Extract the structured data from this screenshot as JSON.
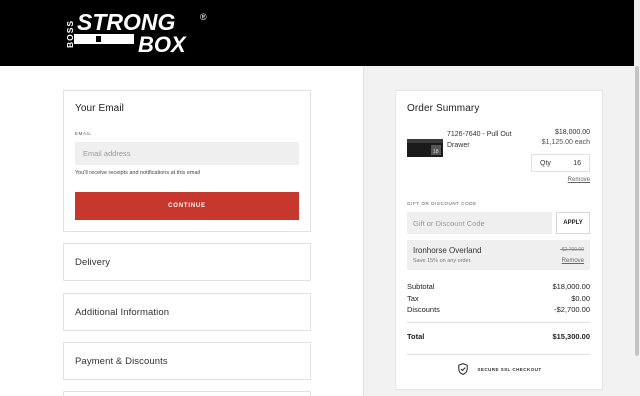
{
  "header": {
    "logo": {
      "wordmark_top": "STRONG",
      "wordmark_bottom": "BOX",
      "registered": "®",
      "vertical_text": "BOSS"
    }
  },
  "email_section": {
    "title": "Your Email",
    "field_label": "EMAIL",
    "placeholder": "Email address",
    "value": "",
    "helper": "You'll receive receipts and notifications at this email",
    "continue_label": "CONTINUE"
  },
  "sections": [
    {
      "title": "Delivery"
    },
    {
      "title": "Additional Information"
    },
    {
      "title": "Payment & Discounts"
    }
  ],
  "order_summary": {
    "title": "Order Summary",
    "item": {
      "name": "7126-7640 - Pull Out Drawer",
      "price": "$18,000.00",
      "unit_price": "$1,125.00 each",
      "qty_label": "Qty",
      "qty_value": "16",
      "remove_label": "Remove",
      "thumbnail": "drawer-product-image"
    },
    "gift": {
      "label": "GIFT OR DISCOUNT CODE",
      "placeholder": "Gift or Discount Code",
      "apply_label": "APPLY"
    },
    "discount": {
      "name": "Ironhorse Overland",
      "description": "Save 15% on any order.",
      "amount": "-$2,700.00",
      "remove_label": "Remove"
    },
    "totals": [
      {
        "label": "Subtotal",
        "value": "$18,000.00"
      },
      {
        "label": "Tax",
        "value": "$0.00"
      },
      {
        "label": "Discounts",
        "value": "-$2,700.00"
      }
    ],
    "total": {
      "label": "Total",
      "value": "$15,300.00"
    },
    "secure_label": "SECURE SSL CHECKOUT",
    "secure_icon": "shield-check-icon"
  },
  "colors": {
    "header_bg": "#000000",
    "accent": "#c8372d",
    "panel_bg": "#f2f2f2",
    "field_bg": "#efefef"
  }
}
